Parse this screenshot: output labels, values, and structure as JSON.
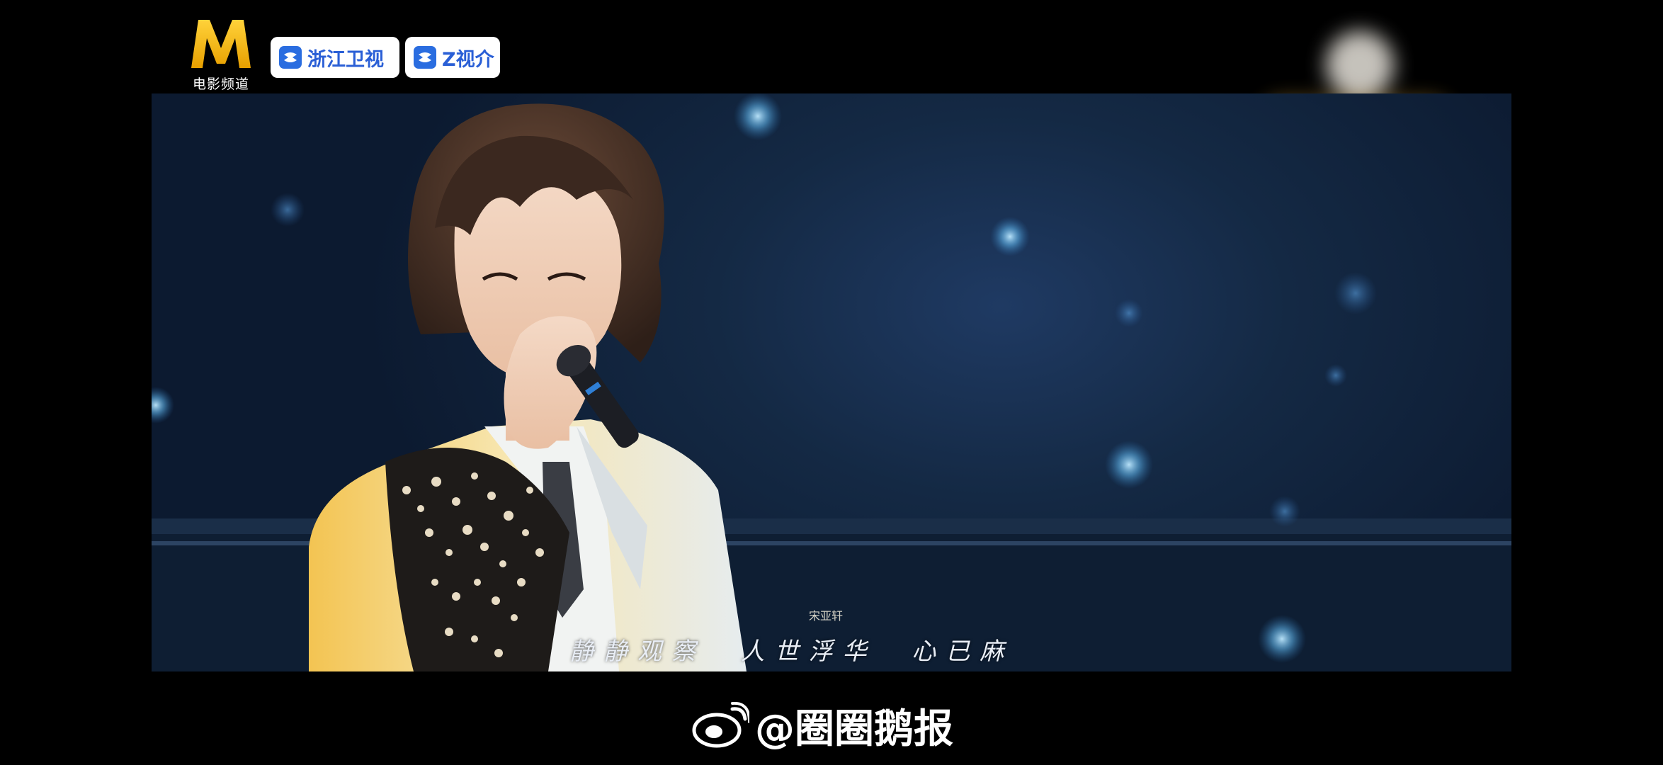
{
  "channel_logos": {
    "movie_channel_caption": "电影频道",
    "zhejiang_tv_label": "浙江卫视",
    "z_video_label": "Z视介"
  },
  "video": {
    "lyrics": "静静观察  人世浮华  心已麻",
    "credit": "宋亚轩"
  },
  "watermark": {
    "text": "@圈圈鹅报"
  },
  "colors": {
    "background": "#000000",
    "stage_blue": "#142944",
    "logo_gold": "#f5b800",
    "badge_blue": "#2a5fd6"
  }
}
